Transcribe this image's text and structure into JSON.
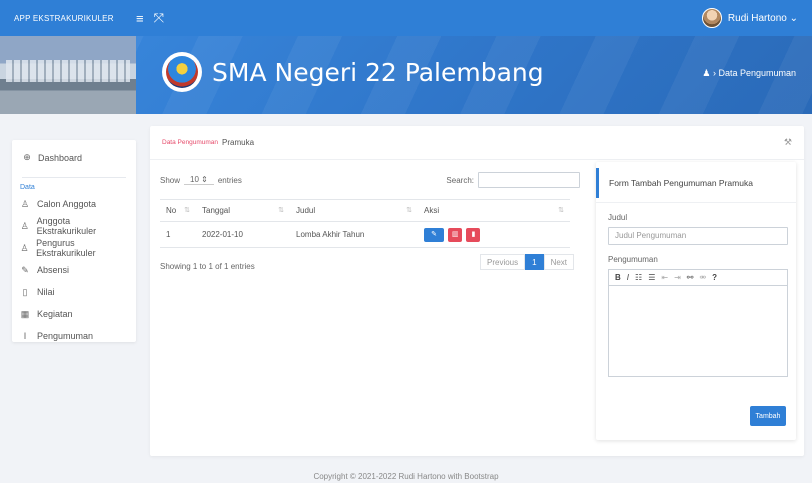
{
  "topbar": {
    "brand": "APP EKSTRAKURIKULER",
    "menu_icon": "≡",
    "expand_icon": "⤧",
    "user_name": "Rudi Hartono ⌄"
  },
  "banner": {
    "school_name": "SMA Negeri 22 Palembang",
    "breadcrumb": "› Data Pengumuman"
  },
  "sidebar": {
    "dashboard": "Dashboard",
    "section": "Data",
    "items": [
      {
        "icon": "user-outline-icon",
        "glyph": "♙",
        "label": "Calon Anggota"
      },
      {
        "icon": "user-outline-icon",
        "glyph": "♙",
        "label": "Anggota Ekstrakurikuler"
      },
      {
        "icon": "user-outline-icon",
        "glyph": "♙",
        "label": "Pengurus Ekstrakurikuler"
      },
      {
        "icon": "edit-square-icon",
        "glyph": "✎",
        "label": "Absensi"
      },
      {
        "icon": "book-icon",
        "glyph": "▯",
        "label": "Nilai"
      },
      {
        "icon": "calendar-icon",
        "glyph": "▦",
        "label": "Kegiatan"
      },
      {
        "icon": "info-icon",
        "glyph": "I",
        "label": "Pengumuman"
      }
    ]
  },
  "main": {
    "tag": "Data Pengumuman",
    "title": "Pramuka",
    "show": "Show",
    "length": "10",
    "entries": "entries",
    "search_label": "Search:",
    "columns": [
      "No",
      "Tanggal",
      "Judul",
      "Aksi"
    ],
    "rows": [
      {
        "no": "1",
        "tanggal": "2022-01-10",
        "judul": "Lomba Akhir Tahun"
      }
    ],
    "info": "Showing 1 to 1 of 1 entries",
    "prev": "Previous",
    "page": "1",
    "next": "Next"
  },
  "form": {
    "title": "Form Tambah Pengumuman Pramuka",
    "judul_label": "Judul",
    "judul_placeholder": "Judul Pengumuman",
    "pengumuman_label": "Pengumuman",
    "submit": "Tambah"
  },
  "footer": "Copyright © 2021-2022 Rudi Hartono with Bootstrap"
}
